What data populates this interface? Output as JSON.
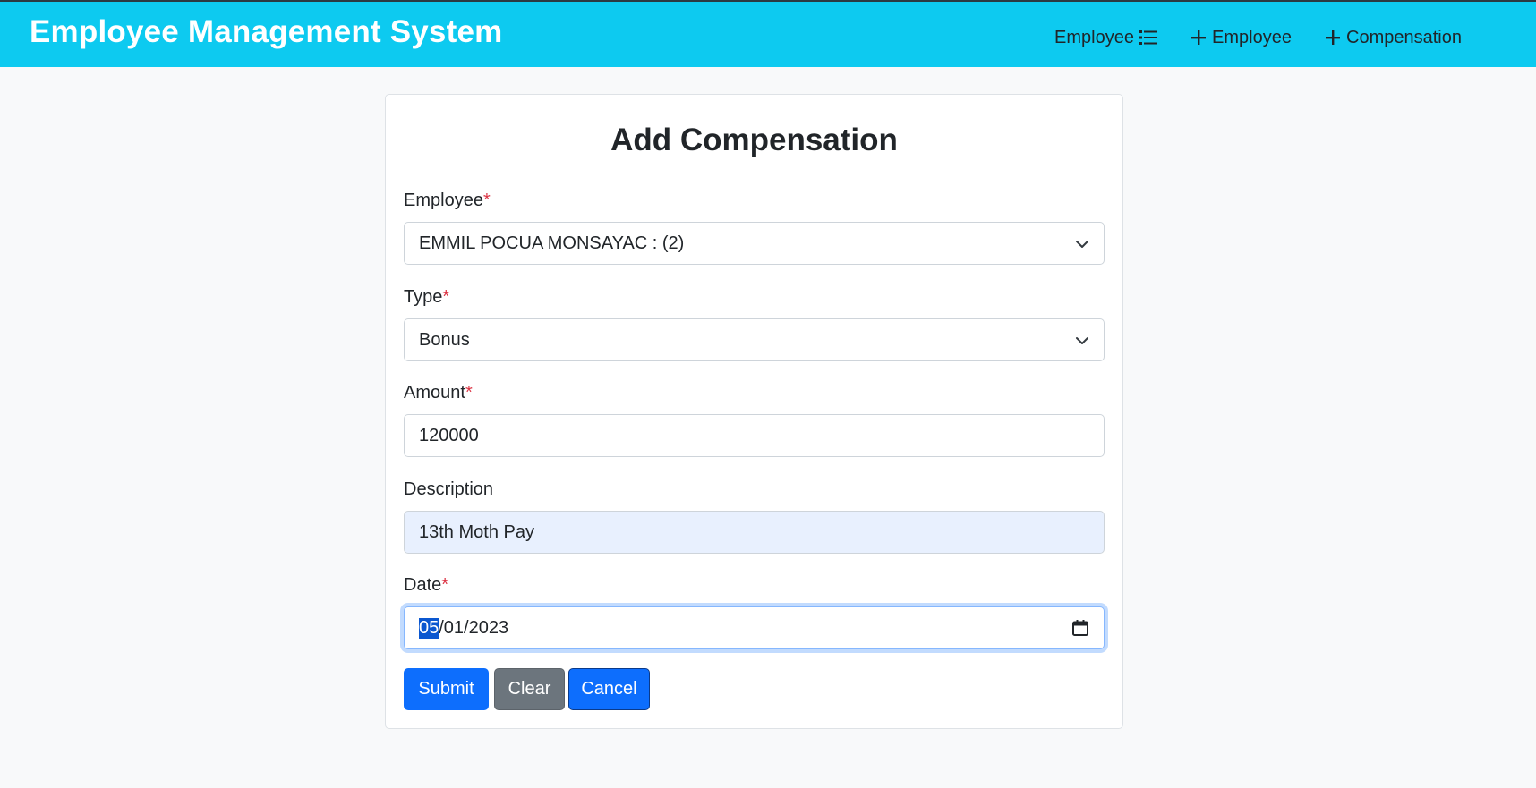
{
  "app": {
    "title": "Employee Management System"
  },
  "nav": {
    "items": [
      {
        "label": "Employee",
        "icon": "list-icon"
      },
      {
        "label": "Employee",
        "icon": "plus-icon"
      },
      {
        "label": "Compensation",
        "icon": "plus-icon"
      }
    ]
  },
  "form": {
    "title": "Add Compensation",
    "required_mark": "*",
    "employee": {
      "label": "Employee",
      "value": "EMMIL POCUA MONSAYAC : (2)"
    },
    "type": {
      "label": "Type",
      "value": "Bonus"
    },
    "amount": {
      "label": "Amount",
      "value": "120000"
    },
    "description": {
      "label": "Description",
      "value": "13th Moth Pay"
    },
    "date": {
      "label": "Date",
      "month": "05",
      "rest": "/01/2023"
    },
    "buttons": {
      "submit": "Submit",
      "clear": "Clear",
      "cancel": "Cancel"
    }
  },
  "colors": {
    "header": "#0dcaf0",
    "primary": "#0d6efd",
    "secondary": "#6c757d",
    "required": "#dc3545"
  }
}
